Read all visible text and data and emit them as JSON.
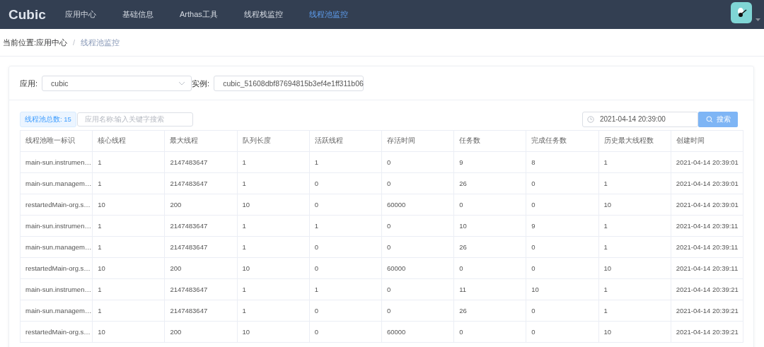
{
  "header": {
    "logo": "Cubic",
    "nav": [
      {
        "label": "应用中心",
        "selected": false
      },
      {
        "label": "基础信息",
        "selected": false
      },
      {
        "label": "Arthas工具",
        "selected": false
      },
      {
        "label": "线程栈监控",
        "selected": false
      },
      {
        "label": "线程池监控",
        "selected": true
      }
    ]
  },
  "breadcrumb": {
    "prefix": "当前位置:",
    "items": [
      "应用中心",
      "线程池监控"
    ],
    "separator": "/"
  },
  "filters": {
    "app_label": "应用:",
    "app_value": "cubic",
    "instance_label": "实例:",
    "instance_value": "cubic_51608dbf87694815b3ef4e1ff311b06"
  },
  "toolbar": {
    "total_tag": "线程池总数: 15",
    "search_placeholder": "应用名称:输入关键字搜索",
    "time_value": "2021-04-14 20:39:00",
    "search_button": "搜索"
  },
  "table": {
    "columns": [
      "线程池唯一标识",
      "核心线程",
      "最大线程",
      "队列长度",
      "活跃线程",
      "存活时间",
      "任务数",
      "完成任务数",
      "历史最大线程数",
      "创建时间"
    ],
    "rows": [
      [
        "main-sun.instrumen…",
        "1",
        "2147483647",
        "1",
        "1",
        "0",
        "9",
        "8",
        "1",
        "2021-04-14 20:39:01"
      ],
      [
        "main-sun.managem…",
        "1",
        "2147483647",
        "1",
        "0",
        "0",
        "26",
        "0",
        "1",
        "2021-04-14 20:39:01"
      ],
      [
        "restartedMain-org.s…",
        "10",
        "200",
        "10",
        "0",
        "60000",
        "0",
        "0",
        "10",
        "2021-04-14 20:39:01"
      ],
      [
        "main-sun.instrumen…",
        "1",
        "2147483647",
        "1",
        "1",
        "0",
        "10",
        "9",
        "1",
        "2021-04-14 20:39:11"
      ],
      [
        "main-sun.managem…",
        "1",
        "2147483647",
        "1",
        "0",
        "0",
        "26",
        "0",
        "1",
        "2021-04-14 20:39:11"
      ],
      [
        "restartedMain-org.s…",
        "10",
        "200",
        "10",
        "0",
        "60000",
        "0",
        "0",
        "10",
        "2021-04-14 20:39:11"
      ],
      [
        "main-sun.instrumen…",
        "1",
        "2147483647",
        "1",
        "1",
        "0",
        "11",
        "10",
        "1",
        "2021-04-14 20:39:21"
      ],
      [
        "main-sun.managem…",
        "1",
        "2147483647",
        "1",
        "0",
        "0",
        "26",
        "0",
        "1",
        "2021-04-14 20:39:21"
      ],
      [
        "restartedMain-org.s…",
        "10",
        "200",
        "10",
        "0",
        "60000",
        "0",
        "0",
        "10",
        "2021-04-14 20:39:21"
      ]
    ]
  }
}
